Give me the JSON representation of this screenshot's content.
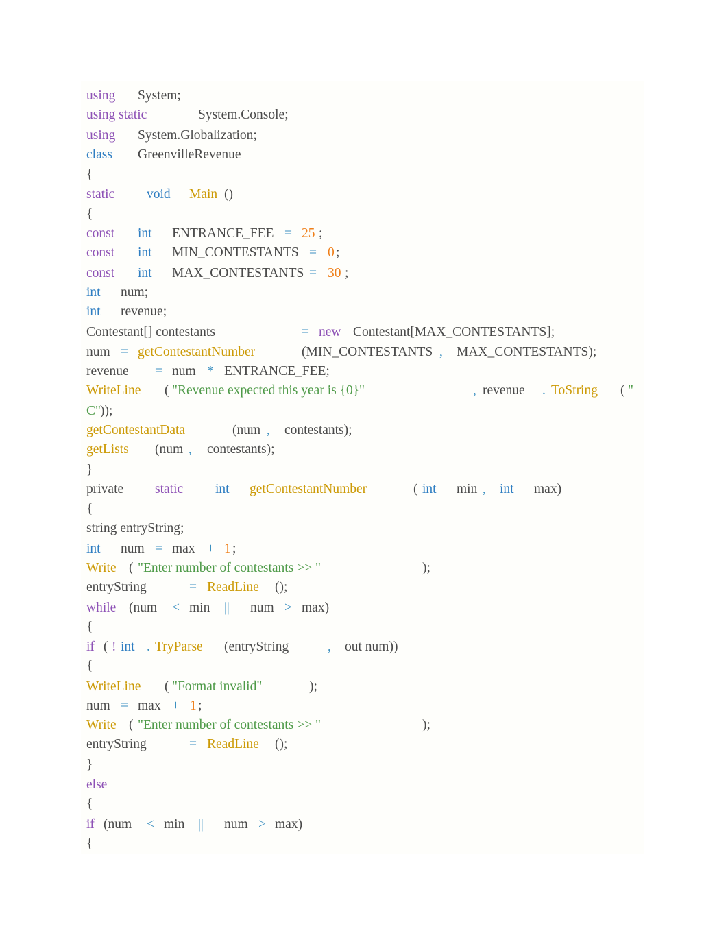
{
  "document": {
    "language": "C#",
    "lines": [
      [
        [
          "kw",
          "using"
        ],
        [
          "plain",
          "System;"
        ]
      ],
      [
        [
          "kw",
          "using static"
        ],
        [
          "plain",
          "System.Console;"
        ]
      ],
      [
        [
          "kw",
          "using"
        ],
        [
          "plain",
          "System.Globalization;"
        ]
      ],
      [
        [
          "type",
          "class"
        ],
        [
          "plain",
          "GreenvilleRevenue"
        ]
      ],
      [
        [
          "plain",
          "{"
        ]
      ],
      [
        [
          "kw",
          "static"
        ],
        [
          "type",
          "void"
        ],
        [
          "fn",
          "Main"
        ],
        [
          "plain",
          "()"
        ]
      ],
      [
        [
          "plain",
          "{"
        ]
      ],
      [
        [
          "kw",
          "const"
        ],
        [
          "type",
          "int"
        ],
        [
          "plain",
          "ENTRANCE_FEE"
        ],
        [
          "op",
          "="
        ],
        [
          "num",
          "25"
        ],
        [
          "plain",
          ";"
        ]
      ],
      [
        [
          "kw",
          "const"
        ],
        [
          "type",
          "int"
        ],
        [
          "plain",
          "MIN_CONTESTANTS"
        ],
        [
          "op",
          "="
        ],
        [
          "num",
          "0"
        ],
        [
          "plain",
          ";"
        ]
      ],
      [
        [
          "kw",
          "const"
        ],
        [
          "type",
          "int"
        ],
        [
          "plain",
          "MAX_CONTESTANTS"
        ],
        [
          "op",
          "="
        ],
        [
          "num",
          "30"
        ],
        [
          "plain",
          ";"
        ]
      ],
      [
        [
          "type",
          "int"
        ],
        [
          "plain",
          "num;"
        ]
      ],
      [
        [
          "type",
          "int"
        ],
        [
          "plain",
          "revenue;"
        ]
      ],
      [
        [
          "plain",
          "Contestant[] contestants"
        ],
        [
          "op",
          "="
        ],
        [
          "kw",
          "new"
        ],
        [
          "plain",
          "Contestant[MAX_CONTESTANTS];"
        ]
      ],
      [
        [
          "plain",
          "num"
        ],
        [
          "op",
          "="
        ],
        [
          "fn",
          "getContestantNumber"
        ],
        [
          "plain",
          "(MIN_CONTESTANTS"
        ],
        [
          "op",
          ","
        ],
        [
          "plain",
          "MAX_CONTESTANTS);"
        ]
      ],
      [
        [
          "plain",
          "revenue"
        ],
        [
          "op",
          "="
        ],
        [
          "plain",
          "num"
        ],
        [
          "op",
          "*"
        ],
        [
          "plain",
          "ENTRANCE_FEE;"
        ]
      ],
      [
        [
          "fn",
          "WriteLine"
        ],
        [
          "plain",
          "("
        ],
        [
          "str",
          "\"Revenue expected this year is {0}\""
        ],
        [
          "op",
          ","
        ],
        [
          "plain",
          "revenue"
        ],
        [
          "op",
          "."
        ],
        [
          "fn",
          "ToString"
        ],
        [
          "plain",
          "("
        ],
        [
          "str",
          "\""
        ]
      ],
      [
        [
          "str",
          "C\""
        ],
        [
          "plain",
          "));"
        ]
      ],
      [
        [
          "fn",
          "getContestantData"
        ],
        [
          "plain",
          "(num"
        ],
        [
          "op",
          ","
        ],
        [
          "plain",
          "contestants);"
        ]
      ],
      [
        [
          "fn",
          "getLists"
        ],
        [
          "plain",
          "(num"
        ],
        [
          "op",
          ","
        ],
        [
          "plain",
          "contestants);"
        ]
      ],
      [
        [
          "plain",
          "}"
        ]
      ],
      [
        [
          "plain",
          "private"
        ],
        [
          "kw",
          "static"
        ],
        [
          "type",
          "int"
        ],
        [
          "fn",
          "getContestantNumber"
        ],
        [
          "plain",
          "("
        ],
        [
          "type",
          "int"
        ],
        [
          "plain",
          "min"
        ],
        [
          "op",
          ","
        ],
        [
          "type",
          "int"
        ],
        [
          "plain",
          "max)"
        ]
      ],
      [
        [
          "plain",
          "{"
        ]
      ],
      [
        [
          "plain",
          "string entryString;"
        ]
      ],
      [
        [
          "type",
          "int"
        ],
        [
          "plain",
          "num"
        ],
        [
          "op",
          "="
        ],
        [
          "plain",
          "max"
        ],
        [
          "op",
          "+"
        ],
        [
          "num",
          "1"
        ],
        [
          "plain",
          ";"
        ]
      ],
      [
        [
          "fn",
          "Write"
        ],
        [
          "plain",
          "("
        ],
        [
          "str",
          "\"Enter number of contestants >> \""
        ],
        [
          "plain",
          ");"
        ]
      ],
      [
        [
          "plain",
          "entryString"
        ],
        [
          "op",
          "="
        ],
        [
          "fn",
          "ReadLine"
        ],
        [
          "plain",
          "();"
        ]
      ],
      [
        [
          "kw",
          "while"
        ],
        [
          "plain",
          "(num"
        ],
        [
          "op",
          "<"
        ],
        [
          "plain",
          "min"
        ],
        [
          "op",
          "||"
        ],
        [
          "plain",
          "num"
        ],
        [
          "op",
          ">"
        ],
        [
          "plain",
          "max)"
        ]
      ],
      [
        [
          "plain",
          "{"
        ]
      ],
      [
        [
          "kw",
          "if"
        ],
        [
          "plain",
          "("
        ],
        [
          "kw",
          "!"
        ],
        [
          "type",
          "int"
        ],
        [
          "op",
          "."
        ],
        [
          "fn",
          "TryParse"
        ],
        [
          "plain",
          "(entryString"
        ],
        [
          "op",
          ","
        ],
        [
          "plain",
          "out num))"
        ]
      ],
      [
        [
          "plain",
          "{"
        ]
      ],
      [
        [
          "fn",
          "WriteLine"
        ],
        [
          "plain",
          "("
        ],
        [
          "str",
          "\"Format invalid\""
        ],
        [
          "plain",
          ");"
        ]
      ],
      [
        [
          "plain",
          "num"
        ],
        [
          "op",
          "="
        ],
        [
          "plain",
          "max"
        ],
        [
          "op",
          "+"
        ],
        [
          "num",
          "1"
        ],
        [
          "plain",
          ";"
        ]
      ],
      [
        [
          "fn",
          "Write"
        ],
        [
          "plain",
          "("
        ],
        [
          "str",
          "\"Enter number of contestants >> \""
        ],
        [
          "plain",
          ");"
        ]
      ],
      [
        [
          "plain",
          "entryString"
        ],
        [
          "op",
          "="
        ],
        [
          "fn",
          "ReadLine"
        ],
        [
          "plain",
          "();"
        ]
      ],
      [
        [
          "plain",
          "}"
        ]
      ],
      [
        [
          "kw",
          "else"
        ]
      ],
      [
        [
          "plain",
          "{"
        ]
      ],
      [
        [
          "kw",
          "if"
        ],
        [
          "plain",
          "(num"
        ],
        [
          "op",
          "<"
        ],
        [
          "plain",
          "min"
        ],
        [
          "op",
          "||"
        ],
        [
          "plain",
          "num"
        ],
        [
          "op",
          ">"
        ],
        [
          "plain",
          "max)"
        ]
      ],
      [
        [
          "plain",
          "{"
        ]
      ]
    ]
  }
}
